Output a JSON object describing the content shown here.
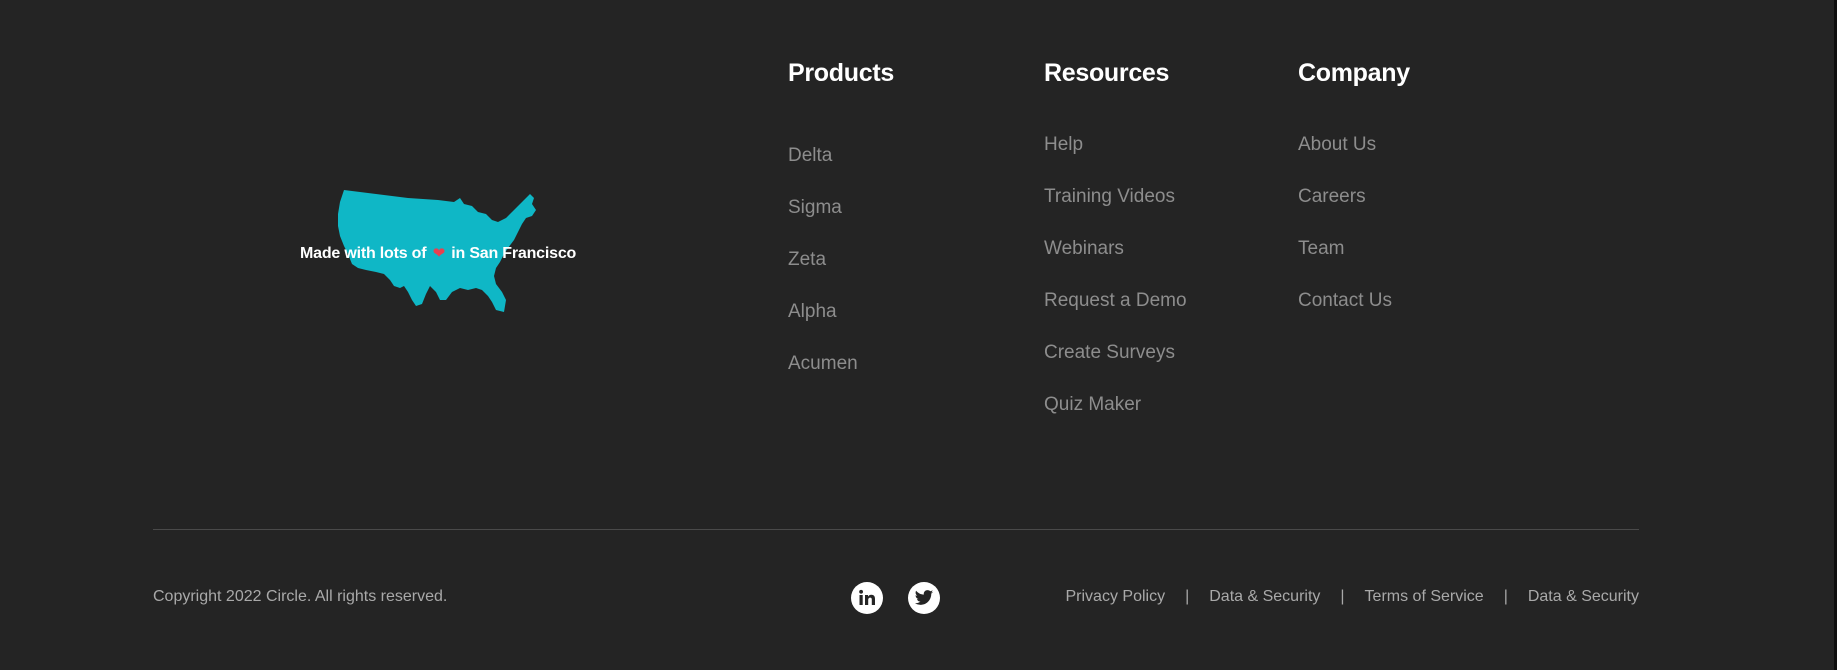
{
  "map": {
    "caption_before": "Made with lots of",
    "heart_icon": "❤",
    "caption_after": "in San Francisco",
    "map_color": "#0fb7c6"
  },
  "footer": {
    "columns": [
      {
        "title": "Products",
        "items": [
          "Delta",
          "Sigma",
          "Zeta",
          "Alpha",
          "Acumen"
        ]
      },
      {
        "title": "Resources",
        "items": [
          "Help",
          "Training Videos",
          "Webinars",
          "Request a Demo",
          "Create Surveys",
          "Quiz Maker"
        ]
      },
      {
        "title": "Company",
        "items": [
          "About Us",
          "Careers",
          "Team",
          "Contact Us"
        ]
      }
    ],
    "copyright": "Copyright 2022 Circle. All rights reserved.",
    "social": [
      "linkedin-icon",
      "twitter-icon"
    ],
    "legal": {
      "separator": "|",
      "links": [
        "Privacy Policy",
        "Data & Security",
        "Terms of Service",
        "Data & Security"
      ]
    }
  },
  "colors": {
    "background": "#242424",
    "heading": "#ffffff",
    "link": "#8d8d8d",
    "muted": "#a9a9a9",
    "divider": "#4a4a4a"
  }
}
